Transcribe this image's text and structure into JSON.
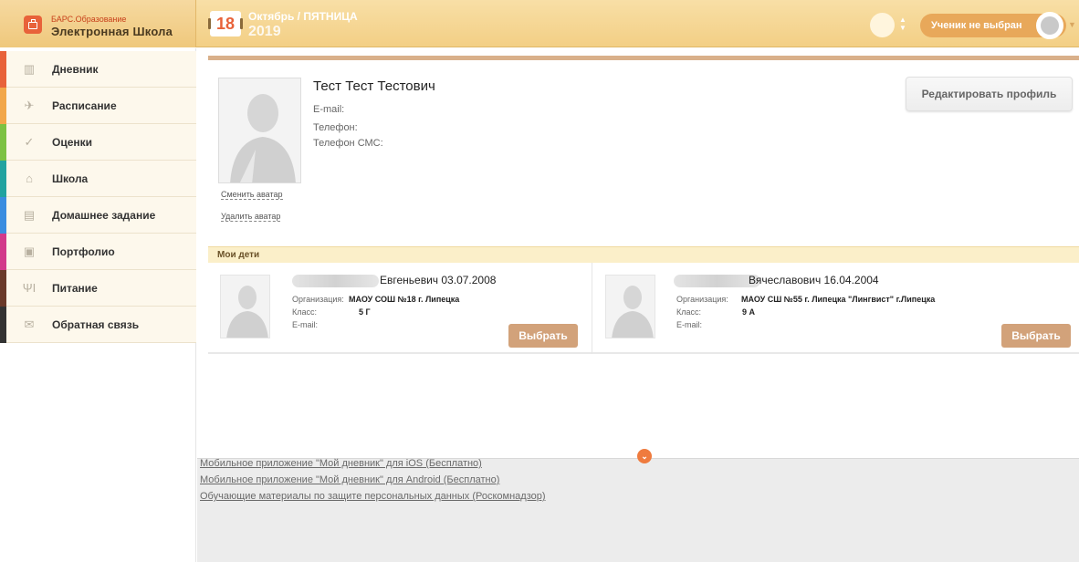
{
  "brand": {
    "small": "БАРС.Образование",
    "big": "Электронная Школа"
  },
  "date": {
    "day": "18",
    "month_line": "Октябрь / ПЯТНИЦА",
    "year": "2019"
  },
  "student_selector": {
    "label": "Ученик не выбран"
  },
  "sidebar": {
    "items": [
      {
        "label": "Дневник",
        "icon": "diary-icon",
        "color": "#e8623a"
      },
      {
        "label": "Расписание",
        "icon": "paper-plane-icon",
        "color": "#f2a74a"
      },
      {
        "label": "Оценки",
        "icon": "checkmark-icon",
        "color": "#7cc243"
      },
      {
        "label": "Школа",
        "icon": "school-icon",
        "color": "#21a3a0"
      },
      {
        "label": "Домашнее задание",
        "icon": "homework-icon",
        "color": "#3a8de0"
      },
      {
        "label": "Портфолио",
        "icon": "portfolio-icon",
        "color": "#d23a8a"
      },
      {
        "label": "Питание",
        "icon": "fork-knife-icon",
        "color": "#6a3a2a"
      },
      {
        "label": "Обратная связь",
        "icon": "envelope-icon",
        "color": "#333333"
      }
    ]
  },
  "profile": {
    "name": "Тест Тест Тестович",
    "email_label": "E-mail:",
    "phone_label": "Телефон:",
    "sms_label": "Телефон СМС:",
    "change_avatar": "Сменить аватар",
    "delete_avatar": "Удалить аватар",
    "edit_button": "Редактировать профиль"
  },
  "children": {
    "title": "Мои дети",
    "org_label": "Организация:",
    "class_label": "Класс:",
    "email_label": "E-mail:",
    "choose_label": "Выбрать",
    "list": [
      {
        "name_visible": "Евгеньевич 03.07.2008",
        "org": "МАОУ СОШ №18 г. Липецка",
        "class": "5 Г"
      },
      {
        "name_visible": "Вячеславович 16.04.2004",
        "org": "МАОУ СШ №55 г. Липецка \"Лингвист\" г.Липецка",
        "class": "9 А"
      }
    ]
  },
  "footer": {
    "links": [
      "Мобильное приложение \"Мой дневник\" для iOS (Бесплатно)",
      "Мобильное приложение \"Мой дневник\" для Android (Бесплатно)",
      "Обучающие материалы по защите персональных данных (Роскомнадзор)"
    ]
  },
  "colors": {
    "accent": "#e8623a",
    "topbar": "#f3cf85",
    "choose_button": "#d2a27a"
  }
}
